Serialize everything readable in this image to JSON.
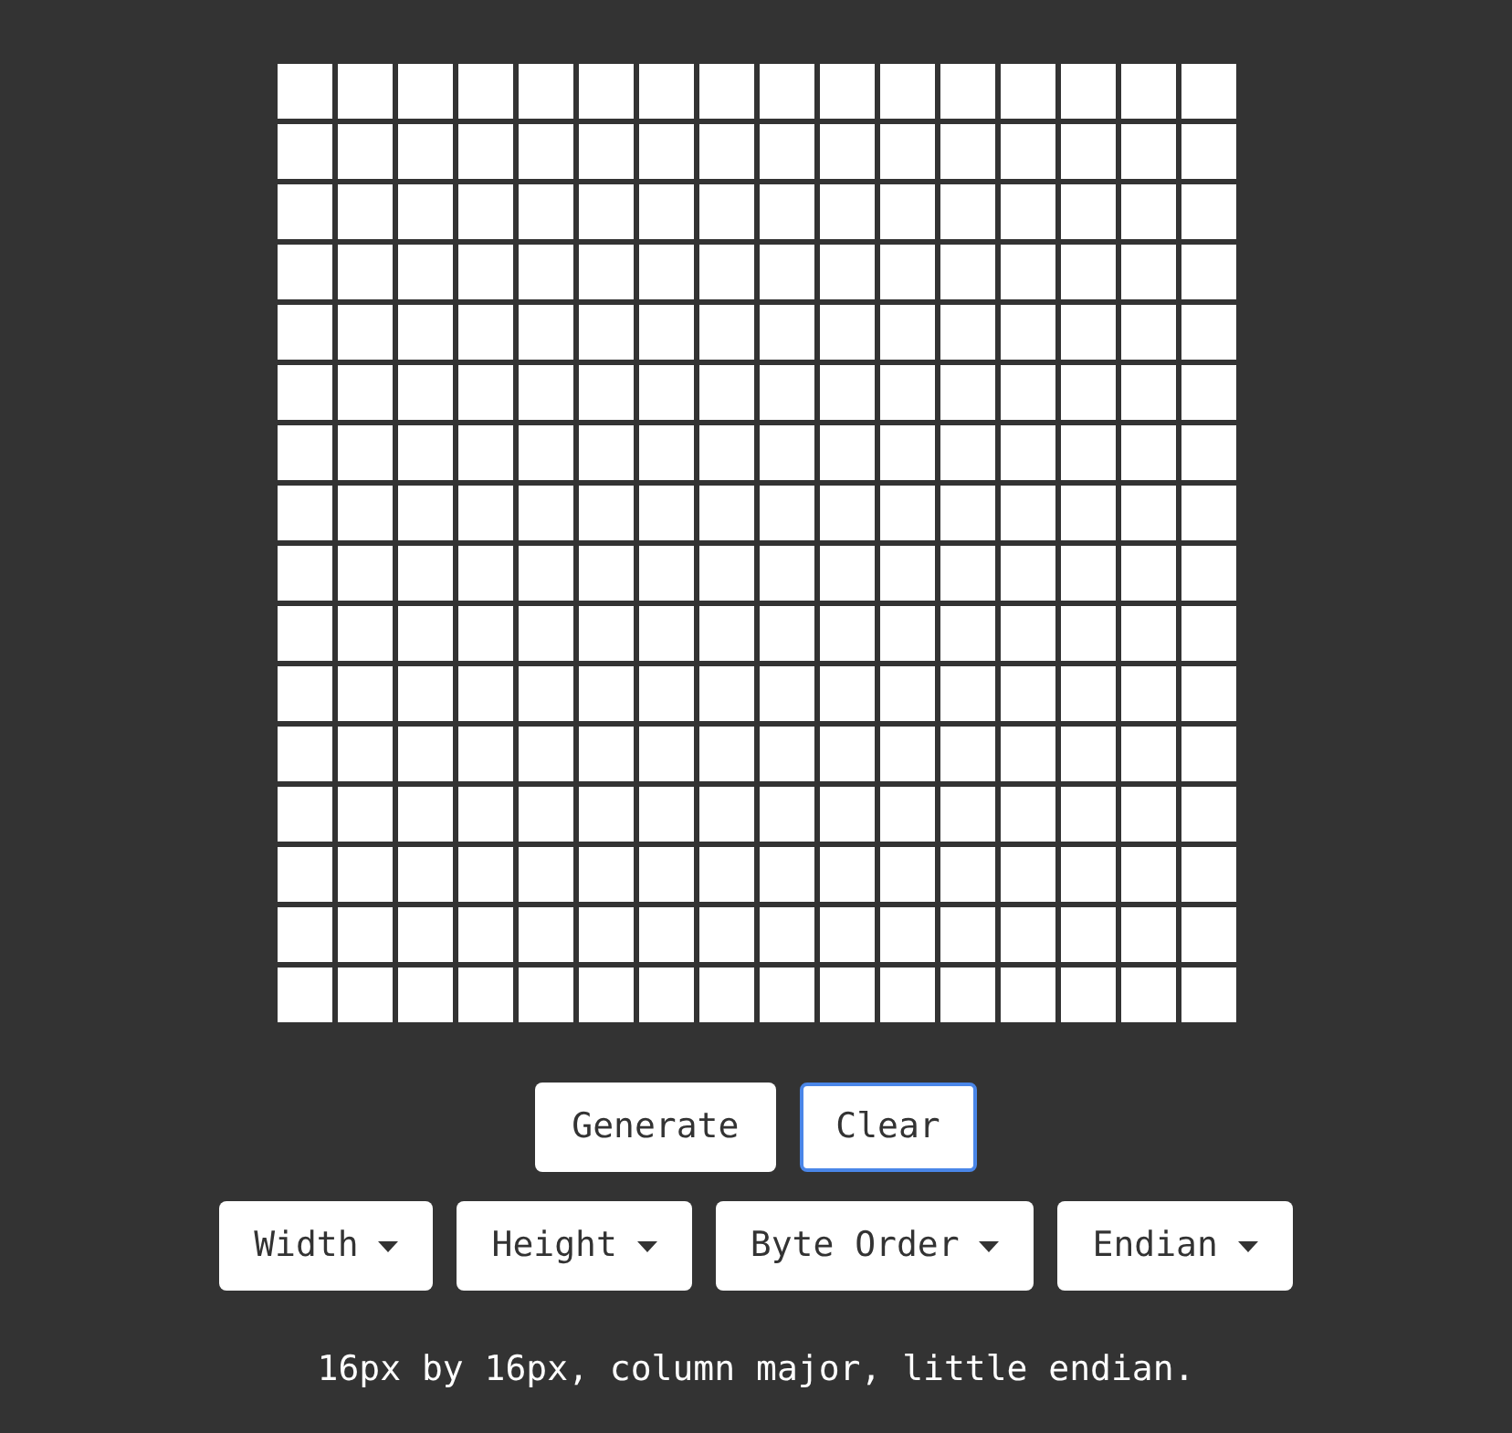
{
  "grid": [
    [
      {
        "on": false
      },
      {
        "on": false
      },
      {
        "on": false
      },
      {
        "on": false
      },
      {
        "on": false
      },
      {
        "on": false
      },
      {
        "on": false
      },
      {
        "on": false
      },
      {
        "on": false
      },
      {
        "on": false
      },
      {
        "on": false
      },
      {
        "on": false
      },
      {
        "on": false
      },
      {
        "on": false
      },
      {
        "on": false
      },
      {
        "on": false
      }
    ],
    [
      {
        "on": false
      },
      {
        "on": false
      },
      {
        "on": false
      },
      {
        "on": false
      },
      {
        "on": false
      },
      {
        "on": false
      },
      {
        "on": false
      },
      {
        "on": false
      },
      {
        "on": false
      },
      {
        "on": false
      },
      {
        "on": false
      },
      {
        "on": false
      },
      {
        "on": false
      },
      {
        "on": false
      },
      {
        "on": false
      },
      {
        "on": false
      }
    ],
    [
      {
        "on": false
      },
      {
        "on": false
      },
      {
        "on": false
      },
      {
        "on": false
      },
      {
        "on": false
      },
      {
        "on": false
      },
      {
        "on": false
      },
      {
        "on": false
      },
      {
        "on": false
      },
      {
        "on": false
      },
      {
        "on": false
      },
      {
        "on": false
      },
      {
        "on": false
      },
      {
        "on": false
      },
      {
        "on": false
      },
      {
        "on": false
      }
    ],
    [
      {
        "on": false
      },
      {
        "on": false
      },
      {
        "on": false
      },
      {
        "on": false
      },
      {
        "on": false
      },
      {
        "on": false
      },
      {
        "on": false
      },
      {
        "on": false
      },
      {
        "on": false
      },
      {
        "on": false
      },
      {
        "on": false
      },
      {
        "on": false
      },
      {
        "on": false
      },
      {
        "on": false
      },
      {
        "on": false
      },
      {
        "on": false
      }
    ],
    [
      {
        "on": false
      },
      {
        "on": false
      },
      {
        "on": false
      },
      {
        "on": false
      },
      {
        "on": false
      },
      {
        "on": false
      },
      {
        "on": false
      },
      {
        "on": false
      },
      {
        "on": false
      },
      {
        "on": false
      },
      {
        "on": false
      },
      {
        "on": false
      },
      {
        "on": false
      },
      {
        "on": false
      },
      {
        "on": false
      },
      {
        "on": false
      }
    ],
    [
      {
        "on": false
      },
      {
        "on": false
      },
      {
        "on": false
      },
      {
        "on": false
      },
      {
        "on": false
      },
      {
        "on": false
      },
      {
        "on": false
      },
      {
        "on": false
      },
      {
        "on": false
      },
      {
        "on": false
      },
      {
        "on": false
      },
      {
        "on": false
      },
      {
        "on": false
      },
      {
        "on": false
      },
      {
        "on": false
      },
      {
        "on": false
      }
    ],
    [
      {
        "on": false
      },
      {
        "on": false
      },
      {
        "on": false
      },
      {
        "on": false
      },
      {
        "on": false
      },
      {
        "on": false
      },
      {
        "on": false
      },
      {
        "on": false
      },
      {
        "on": false
      },
      {
        "on": false
      },
      {
        "on": false
      },
      {
        "on": false
      },
      {
        "on": false
      },
      {
        "on": false
      },
      {
        "on": false
      },
      {
        "on": false
      }
    ],
    [
      {
        "on": false
      },
      {
        "on": false
      },
      {
        "on": false
      },
      {
        "on": false
      },
      {
        "on": false
      },
      {
        "on": false
      },
      {
        "on": false
      },
      {
        "on": false
      },
      {
        "on": false
      },
      {
        "on": false
      },
      {
        "on": false
      },
      {
        "on": false
      },
      {
        "on": false
      },
      {
        "on": false
      },
      {
        "on": false
      },
      {
        "on": false
      }
    ],
    [
      {
        "on": false
      },
      {
        "on": false
      },
      {
        "on": false
      },
      {
        "on": false
      },
      {
        "on": false
      },
      {
        "on": false
      },
      {
        "on": false
      },
      {
        "on": false
      },
      {
        "on": false
      },
      {
        "on": false
      },
      {
        "on": false
      },
      {
        "on": false
      },
      {
        "on": false
      },
      {
        "on": false
      },
      {
        "on": false
      },
      {
        "on": false
      }
    ],
    [
      {
        "on": false
      },
      {
        "on": false
      },
      {
        "on": false
      },
      {
        "on": false
      },
      {
        "on": false
      },
      {
        "on": false
      },
      {
        "on": false
      },
      {
        "on": false
      },
      {
        "on": false
      },
      {
        "on": false
      },
      {
        "on": false
      },
      {
        "on": false
      },
      {
        "on": false
      },
      {
        "on": false
      },
      {
        "on": false
      },
      {
        "on": false
      }
    ],
    [
      {
        "on": false
      },
      {
        "on": false
      },
      {
        "on": false
      },
      {
        "on": false
      },
      {
        "on": false
      },
      {
        "on": false
      },
      {
        "on": false
      },
      {
        "on": false
      },
      {
        "on": false
      },
      {
        "on": false
      },
      {
        "on": false
      },
      {
        "on": false
      },
      {
        "on": false
      },
      {
        "on": false
      },
      {
        "on": false
      },
      {
        "on": false
      }
    ],
    [
      {
        "on": false
      },
      {
        "on": false
      },
      {
        "on": false
      },
      {
        "on": false
      },
      {
        "on": false
      },
      {
        "on": false
      },
      {
        "on": false
      },
      {
        "on": false
      },
      {
        "on": false
      },
      {
        "on": false
      },
      {
        "on": false
      },
      {
        "on": false
      },
      {
        "on": false
      },
      {
        "on": false
      },
      {
        "on": false
      },
      {
        "on": false
      }
    ],
    [
      {
        "on": false
      },
      {
        "on": false
      },
      {
        "on": false
      },
      {
        "on": false
      },
      {
        "on": false
      },
      {
        "on": false
      },
      {
        "on": false
      },
      {
        "on": false
      },
      {
        "on": false
      },
      {
        "on": false
      },
      {
        "on": false
      },
      {
        "on": false
      },
      {
        "on": false
      },
      {
        "on": false
      },
      {
        "on": false
      },
      {
        "on": false
      }
    ],
    [
      {
        "on": false
      },
      {
        "on": false
      },
      {
        "on": false
      },
      {
        "on": false
      },
      {
        "on": false
      },
      {
        "on": false
      },
      {
        "on": false
      },
      {
        "on": false
      },
      {
        "on": false
      },
      {
        "on": false
      },
      {
        "on": false
      },
      {
        "on": false
      },
      {
        "on": false
      },
      {
        "on": false
      },
      {
        "on": false
      },
      {
        "on": false
      }
    ],
    [
      {
        "on": false
      },
      {
        "on": false
      },
      {
        "on": false
      },
      {
        "on": false
      },
      {
        "on": false
      },
      {
        "on": false
      },
      {
        "on": false
      },
      {
        "on": false
      },
      {
        "on": false
      },
      {
        "on": false
      },
      {
        "on": false
      },
      {
        "on": false
      },
      {
        "on": false
      },
      {
        "on": false
      },
      {
        "on": false
      },
      {
        "on": false
      }
    ],
    [
      {
        "on": false
      },
      {
        "on": false
      },
      {
        "on": false
      },
      {
        "on": false
      },
      {
        "on": false
      },
      {
        "on": false
      },
      {
        "on": false
      },
      {
        "on": false
      },
      {
        "on": false
      },
      {
        "on": false
      },
      {
        "on": false
      },
      {
        "on": false
      },
      {
        "on": false
      },
      {
        "on": false
      },
      {
        "on": false
      },
      {
        "on": false
      }
    ]
  ],
  "actions": [
    {
      "label": "Generate",
      "focused": false
    },
    {
      "label": "Clear",
      "focused": true
    }
  ],
  "dropdowns": [
    {
      "label": "Width"
    },
    {
      "label": "Height"
    },
    {
      "label": "Byte Order"
    },
    {
      "label": "Endian"
    }
  ],
  "summary": "16px by 16px, column major, little endian."
}
